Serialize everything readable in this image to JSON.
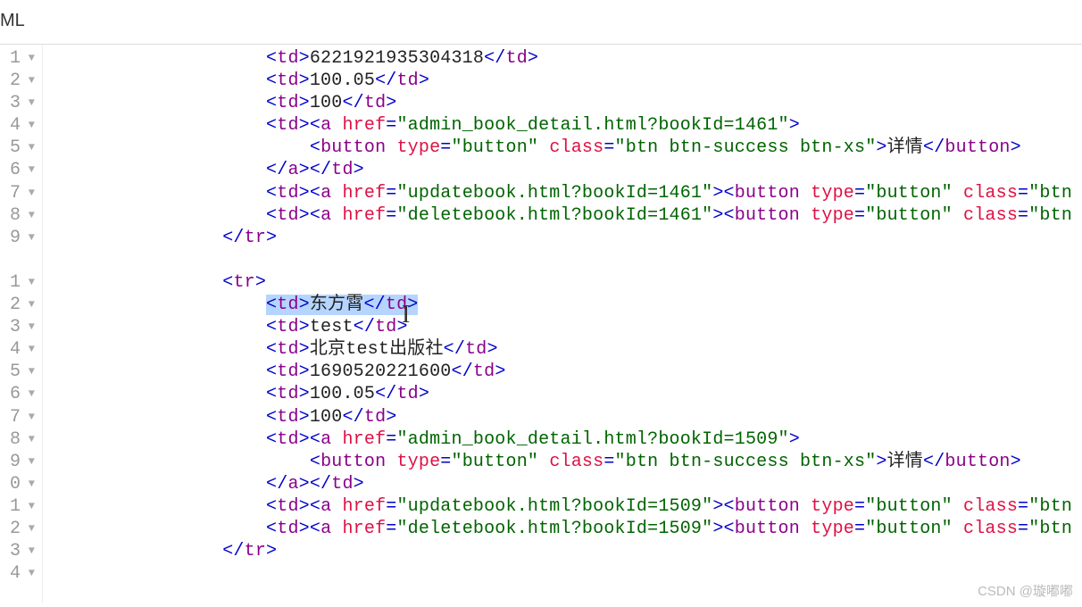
{
  "header": {
    "title": "ML"
  },
  "gutter": {
    "lines": [
      "1",
      "2",
      "3",
      "4",
      "5",
      "6",
      "7",
      "8",
      "9",
      "",
      "1",
      "2",
      "3",
      "4",
      "5",
      "6",
      "7",
      "8",
      "9",
      "0",
      "1",
      "2",
      "3",
      "4",
      ""
    ],
    "fold_icon": "▼"
  },
  "code": {
    "lines": [
      {
        "indent": "                    ",
        "parts": [
          {
            "t": "p",
            "v": "<"
          },
          {
            "t": "tag",
            "v": "td"
          },
          {
            "t": "p",
            "v": ">"
          },
          {
            "t": "txt",
            "v": "6221921935304318"
          },
          {
            "t": "p",
            "v": "</"
          },
          {
            "t": "tag",
            "v": "td"
          },
          {
            "t": "p",
            "v": ">"
          }
        ]
      },
      {
        "indent": "                    ",
        "parts": [
          {
            "t": "p",
            "v": "<"
          },
          {
            "t": "tag",
            "v": "td"
          },
          {
            "t": "p",
            "v": ">"
          },
          {
            "t": "txt",
            "v": "100.05"
          },
          {
            "t": "p",
            "v": "</"
          },
          {
            "t": "tag",
            "v": "td"
          },
          {
            "t": "p",
            "v": ">"
          }
        ]
      },
      {
        "indent": "                    ",
        "parts": [
          {
            "t": "p",
            "v": "<"
          },
          {
            "t": "tag",
            "v": "td"
          },
          {
            "t": "p",
            "v": ">"
          },
          {
            "t": "txt",
            "v": "100"
          },
          {
            "t": "p",
            "v": "</"
          },
          {
            "t": "tag",
            "v": "td"
          },
          {
            "t": "p",
            "v": ">"
          }
        ]
      },
      {
        "indent": "                    ",
        "parts": [
          {
            "t": "p",
            "v": "<"
          },
          {
            "t": "tag",
            "v": "td"
          },
          {
            "t": "p",
            "v": "><"
          },
          {
            "t": "tag",
            "v": "a"
          },
          {
            "t": "txt",
            "v": " "
          },
          {
            "t": "attr",
            "v": "href"
          },
          {
            "t": "p",
            "v": "="
          },
          {
            "t": "str",
            "v": "\"admin_book_detail.html?bookId=1461\""
          },
          {
            "t": "p",
            "v": ">"
          }
        ]
      },
      {
        "indent": "                        ",
        "parts": [
          {
            "t": "p",
            "v": "<"
          },
          {
            "t": "tag",
            "v": "button"
          },
          {
            "t": "txt",
            "v": " "
          },
          {
            "t": "attr",
            "v": "type"
          },
          {
            "t": "p",
            "v": "="
          },
          {
            "t": "str",
            "v": "\"button\""
          },
          {
            "t": "txt",
            "v": " "
          },
          {
            "t": "attr",
            "v": "class"
          },
          {
            "t": "p",
            "v": "="
          },
          {
            "t": "str",
            "v": "\"btn btn-success btn-xs\""
          },
          {
            "t": "p",
            "v": ">"
          },
          {
            "t": "txt",
            "v": "详情"
          },
          {
            "t": "p",
            "v": "</"
          },
          {
            "t": "tag",
            "v": "button"
          },
          {
            "t": "p",
            "v": ">"
          }
        ]
      },
      {
        "indent": "                    ",
        "parts": [
          {
            "t": "p",
            "v": "</"
          },
          {
            "t": "tag",
            "v": "a"
          },
          {
            "t": "p",
            "v": "></"
          },
          {
            "t": "tag",
            "v": "td"
          },
          {
            "t": "p",
            "v": ">"
          }
        ]
      },
      {
        "indent": "                    ",
        "parts": [
          {
            "t": "p",
            "v": "<"
          },
          {
            "t": "tag",
            "v": "td"
          },
          {
            "t": "p",
            "v": "><"
          },
          {
            "t": "tag",
            "v": "a"
          },
          {
            "t": "txt",
            "v": " "
          },
          {
            "t": "attr",
            "v": "href"
          },
          {
            "t": "p",
            "v": "="
          },
          {
            "t": "str",
            "v": "\"updatebook.html?bookId=1461\""
          },
          {
            "t": "p",
            "v": "><"
          },
          {
            "t": "tag",
            "v": "button"
          },
          {
            "t": "txt",
            "v": " "
          },
          {
            "t": "attr",
            "v": "type"
          },
          {
            "t": "p",
            "v": "="
          },
          {
            "t": "str",
            "v": "\"button\""
          },
          {
            "t": "txt",
            "v": " "
          },
          {
            "t": "attr",
            "v": "class"
          },
          {
            "t": "p",
            "v": "="
          },
          {
            "t": "str",
            "v": "\"btn b"
          }
        ]
      },
      {
        "indent": "                    ",
        "parts": [
          {
            "t": "p",
            "v": "<"
          },
          {
            "t": "tag",
            "v": "td"
          },
          {
            "t": "p",
            "v": "><"
          },
          {
            "t": "tag",
            "v": "a"
          },
          {
            "t": "txt",
            "v": " "
          },
          {
            "t": "attr",
            "v": "href"
          },
          {
            "t": "p",
            "v": "="
          },
          {
            "t": "str",
            "v": "\"deletebook.html?bookId=1461\""
          },
          {
            "t": "p",
            "v": "><"
          },
          {
            "t": "tag",
            "v": "button"
          },
          {
            "t": "txt",
            "v": " "
          },
          {
            "t": "attr",
            "v": "type"
          },
          {
            "t": "p",
            "v": "="
          },
          {
            "t": "str",
            "v": "\"button\""
          },
          {
            "t": "txt",
            "v": " "
          },
          {
            "t": "attr",
            "v": "class"
          },
          {
            "t": "p",
            "v": "="
          },
          {
            "t": "str",
            "v": "\"btn b"
          }
        ]
      },
      {
        "indent": "                ",
        "parts": [
          {
            "t": "p",
            "v": "</"
          },
          {
            "t": "tag",
            "v": "tr"
          },
          {
            "t": "p",
            "v": ">"
          }
        ]
      },
      {
        "indent": "",
        "parts": []
      },
      {
        "indent": "                ",
        "parts": [
          {
            "t": "p",
            "v": "<"
          },
          {
            "t": "tag",
            "v": "tr"
          },
          {
            "t": "p",
            "v": ">"
          }
        ]
      },
      {
        "indent": "                    ",
        "hl": true,
        "parts": [
          {
            "t": "p",
            "v": "<"
          },
          {
            "t": "tag",
            "v": "td"
          },
          {
            "t": "p",
            "v": ">"
          },
          {
            "t": "txt",
            "v": "东方霄"
          },
          {
            "t": "p",
            "v": "</"
          },
          {
            "t": "tag",
            "v": "td"
          },
          {
            "t": "p",
            "v": ">"
          }
        ]
      },
      {
        "indent": "                    ",
        "parts": [
          {
            "t": "p",
            "v": "<"
          },
          {
            "t": "tag",
            "v": "td"
          },
          {
            "t": "p",
            "v": ">"
          },
          {
            "t": "txt",
            "v": "test"
          },
          {
            "t": "p",
            "v": "</"
          },
          {
            "t": "tag",
            "v": "td"
          },
          {
            "t": "p",
            "v": ">"
          }
        ]
      },
      {
        "indent": "                    ",
        "parts": [
          {
            "t": "p",
            "v": "<"
          },
          {
            "t": "tag",
            "v": "td"
          },
          {
            "t": "p",
            "v": ">"
          },
          {
            "t": "txt",
            "v": "北京test出版社"
          },
          {
            "t": "p",
            "v": "</"
          },
          {
            "t": "tag",
            "v": "td"
          },
          {
            "t": "p",
            "v": ">"
          }
        ]
      },
      {
        "indent": "                    ",
        "parts": [
          {
            "t": "p",
            "v": "<"
          },
          {
            "t": "tag",
            "v": "td"
          },
          {
            "t": "p",
            "v": ">"
          },
          {
            "t": "txt",
            "v": "1690520221600"
          },
          {
            "t": "p",
            "v": "</"
          },
          {
            "t": "tag",
            "v": "td"
          },
          {
            "t": "p",
            "v": ">"
          }
        ]
      },
      {
        "indent": "                    ",
        "parts": [
          {
            "t": "p",
            "v": "<"
          },
          {
            "t": "tag",
            "v": "td"
          },
          {
            "t": "p",
            "v": ">"
          },
          {
            "t": "txt",
            "v": "100.05"
          },
          {
            "t": "p",
            "v": "</"
          },
          {
            "t": "tag",
            "v": "td"
          },
          {
            "t": "p",
            "v": ">"
          }
        ]
      },
      {
        "indent": "                    ",
        "parts": [
          {
            "t": "p",
            "v": "<"
          },
          {
            "t": "tag",
            "v": "td"
          },
          {
            "t": "p",
            "v": ">"
          },
          {
            "t": "txt",
            "v": "100"
          },
          {
            "t": "p",
            "v": "</"
          },
          {
            "t": "tag",
            "v": "td"
          },
          {
            "t": "p",
            "v": ">"
          }
        ]
      },
      {
        "indent": "                    ",
        "parts": [
          {
            "t": "p",
            "v": "<"
          },
          {
            "t": "tag",
            "v": "td"
          },
          {
            "t": "p",
            "v": "><"
          },
          {
            "t": "tag",
            "v": "a"
          },
          {
            "t": "txt",
            "v": " "
          },
          {
            "t": "attr",
            "v": "href"
          },
          {
            "t": "p",
            "v": "="
          },
          {
            "t": "str",
            "v": "\"admin_book_detail.html?bookId=1509\""
          },
          {
            "t": "p",
            "v": ">"
          }
        ]
      },
      {
        "indent": "                        ",
        "parts": [
          {
            "t": "p",
            "v": "<"
          },
          {
            "t": "tag",
            "v": "button"
          },
          {
            "t": "txt",
            "v": " "
          },
          {
            "t": "attr",
            "v": "type"
          },
          {
            "t": "p",
            "v": "="
          },
          {
            "t": "str",
            "v": "\"button\""
          },
          {
            "t": "txt",
            "v": " "
          },
          {
            "t": "attr",
            "v": "class"
          },
          {
            "t": "p",
            "v": "="
          },
          {
            "t": "str",
            "v": "\"btn btn-success btn-xs\""
          },
          {
            "t": "p",
            "v": ">"
          },
          {
            "t": "txt",
            "v": "详情"
          },
          {
            "t": "p",
            "v": "</"
          },
          {
            "t": "tag",
            "v": "button"
          },
          {
            "t": "p",
            "v": ">"
          }
        ]
      },
      {
        "indent": "                    ",
        "parts": [
          {
            "t": "p",
            "v": "</"
          },
          {
            "t": "tag",
            "v": "a"
          },
          {
            "t": "p",
            "v": "></"
          },
          {
            "t": "tag",
            "v": "td"
          },
          {
            "t": "p",
            "v": ">"
          }
        ]
      },
      {
        "indent": "                    ",
        "parts": [
          {
            "t": "p",
            "v": "<"
          },
          {
            "t": "tag",
            "v": "td"
          },
          {
            "t": "p",
            "v": "><"
          },
          {
            "t": "tag",
            "v": "a"
          },
          {
            "t": "txt",
            "v": " "
          },
          {
            "t": "attr",
            "v": "href"
          },
          {
            "t": "p",
            "v": "="
          },
          {
            "t": "str",
            "v": "\"updatebook.html?bookId=1509\""
          },
          {
            "t": "p",
            "v": "><"
          },
          {
            "t": "tag",
            "v": "button"
          },
          {
            "t": "txt",
            "v": " "
          },
          {
            "t": "attr",
            "v": "type"
          },
          {
            "t": "p",
            "v": "="
          },
          {
            "t": "str",
            "v": "\"button\""
          },
          {
            "t": "txt",
            "v": " "
          },
          {
            "t": "attr",
            "v": "class"
          },
          {
            "t": "p",
            "v": "="
          },
          {
            "t": "str",
            "v": "\"btn b"
          }
        ]
      },
      {
        "indent": "                    ",
        "parts": [
          {
            "t": "p",
            "v": "<"
          },
          {
            "t": "tag",
            "v": "td"
          },
          {
            "t": "p",
            "v": "><"
          },
          {
            "t": "tag",
            "v": "a"
          },
          {
            "t": "txt",
            "v": " "
          },
          {
            "t": "attr",
            "v": "href"
          },
          {
            "t": "p",
            "v": "="
          },
          {
            "t": "str",
            "v": "\"deletebook.html?bookId=1509\""
          },
          {
            "t": "p",
            "v": "><"
          },
          {
            "t": "tag",
            "v": "button"
          },
          {
            "t": "txt",
            "v": " "
          },
          {
            "t": "attr",
            "v": "type"
          },
          {
            "t": "p",
            "v": "="
          },
          {
            "t": "str",
            "v": "\"button\""
          },
          {
            "t": "txt",
            "v": " "
          },
          {
            "t": "attr",
            "v": "class"
          },
          {
            "t": "p",
            "v": "="
          },
          {
            "t": "str",
            "v": "\"btn b"
          }
        ]
      },
      {
        "indent": "                ",
        "parts": [
          {
            "t": "p",
            "v": "</"
          },
          {
            "t": "tag",
            "v": "tr"
          },
          {
            "t": "p",
            "v": ">"
          }
        ]
      },
      {
        "indent": "",
        "parts": []
      },
      {
        "indent": "",
        "parts": []
      }
    ]
  },
  "watermark": "CSDN @璇嘟嘟"
}
